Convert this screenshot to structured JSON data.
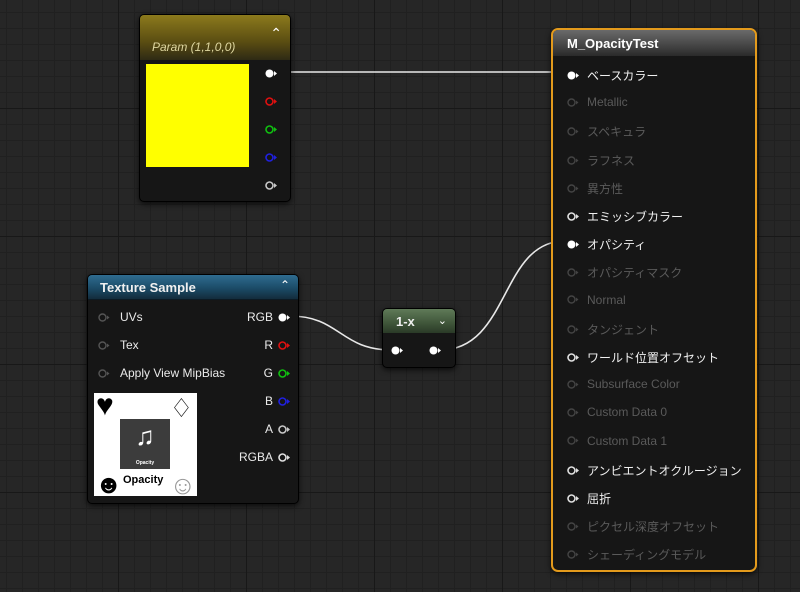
{
  "param_node": {
    "title": "Param (1,1,0,0)",
    "color": "#ffff00",
    "outputs": [
      {
        "name": "pin-out-rgba",
        "color": "#ffffff",
        "connected": true
      },
      {
        "name": "pin-out-r",
        "color": "#e01010",
        "connected": false
      },
      {
        "name": "pin-out-g",
        "color": "#10c010",
        "connected": false
      },
      {
        "name": "pin-out-b",
        "color": "#2020e0",
        "connected": false
      },
      {
        "name": "pin-out-a",
        "color": "#c8c8c8",
        "connected": false
      }
    ]
  },
  "texture_node": {
    "title": "Texture Sample",
    "inputs": [
      "UVs",
      "Tex",
      "Apply View MipBias"
    ],
    "outputs": [
      "RGB",
      "R",
      "G",
      "B",
      "A",
      "RGBA"
    ],
    "thumbnail_text": "Opacity",
    "thumbnail_small_text": "Opacity"
  },
  "oneminus_node": {
    "title": "1-x"
  },
  "material_node": {
    "title": "M_OpacityTest",
    "accent": "#e39a1c",
    "inputs": [
      {
        "label": "ベースカラー",
        "active": true,
        "connected": true
      },
      {
        "label": "Metallic",
        "active": false,
        "connected": false
      },
      {
        "label": "スペキュラ",
        "active": false,
        "connected": false
      },
      {
        "label": "ラフネス",
        "active": false,
        "connected": false
      },
      {
        "label": "異方性",
        "active": false,
        "connected": false
      },
      {
        "label": "エミッシブカラー",
        "active": true,
        "connected": false
      },
      {
        "label": "オパシティ",
        "active": true,
        "connected": true
      },
      {
        "label": "オパシティマスク",
        "active": false,
        "connected": false
      },
      {
        "label": "Normal",
        "active": false,
        "connected": false
      },
      {
        "label": "タンジェント",
        "active": false,
        "connected": false
      },
      {
        "label": "ワールド位置オフセット",
        "active": true,
        "connected": false
      },
      {
        "label": "Subsurface Color",
        "active": false,
        "connected": false
      },
      {
        "label": "Custom Data 0",
        "active": false,
        "connected": false
      },
      {
        "label": "Custom Data 1",
        "active": false,
        "connected": false
      },
      {
        "label": "アンビエントオクルージョン",
        "active": true,
        "connected": false
      },
      {
        "label": "屈折",
        "active": true,
        "connected": false
      },
      {
        "label": "ピクセル深度オフセット",
        "active": false,
        "connected": false
      },
      {
        "label": "シェーディングモデル",
        "active": false,
        "connected": false
      }
    ]
  },
  "wire_color": "#e8e8e8"
}
